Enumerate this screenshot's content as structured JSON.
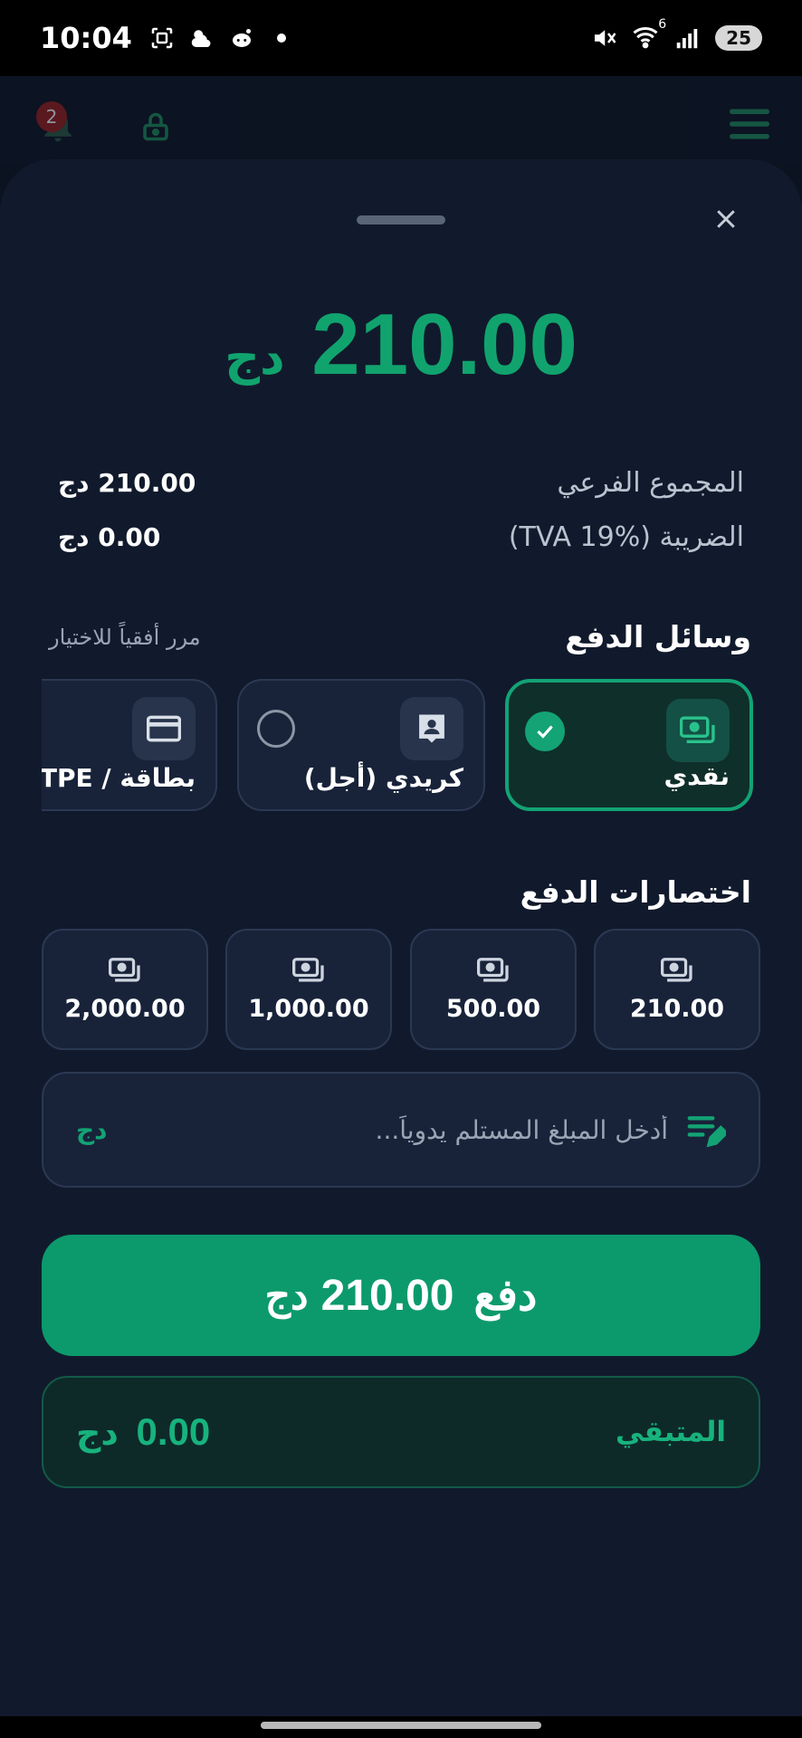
{
  "status_bar": {
    "time": "10:04",
    "battery": "25",
    "wifi_badge": "6"
  },
  "background_header": {
    "notification_count": "2"
  },
  "sheet": {
    "total": {
      "amount": "210.00",
      "currency": "دج"
    },
    "summary": {
      "subtotal_label": "المجموع الفرعي",
      "subtotal_value": "210.00 دج",
      "tax_label": "الضريبة (TVA 19%)",
      "tax_value": "0.00 دج"
    },
    "payment_methods": {
      "title": "وسائل الدفع",
      "hint": "مرر أفقياً للاختيار",
      "items": [
        {
          "label": "نقدي",
          "icon": "cash-icon",
          "selected": true
        },
        {
          "label": "كريدي (أجل)",
          "icon": "contact-icon",
          "selected": false
        },
        {
          "label": "بطاقة / TPE",
          "icon": "credit-card-icon",
          "selected": false
        }
      ]
    },
    "shortcuts": {
      "title": "اختصارات الدفع",
      "items": [
        "210.00",
        "500.00",
        "1,000.00",
        "2,000.00"
      ]
    },
    "manual": {
      "placeholder": "أدخل المبلغ المستلم يدوياً...",
      "currency": "دج"
    },
    "pay_button": {
      "label": "دفع",
      "amount": "210.00",
      "currency": "دج"
    },
    "remaining": {
      "label": "المتبقي",
      "amount": "0.00",
      "currency": "دج"
    }
  },
  "colors": {
    "accent": "#13a374",
    "sheet_bg": "#111a2c",
    "card_bg": "#18233a"
  }
}
